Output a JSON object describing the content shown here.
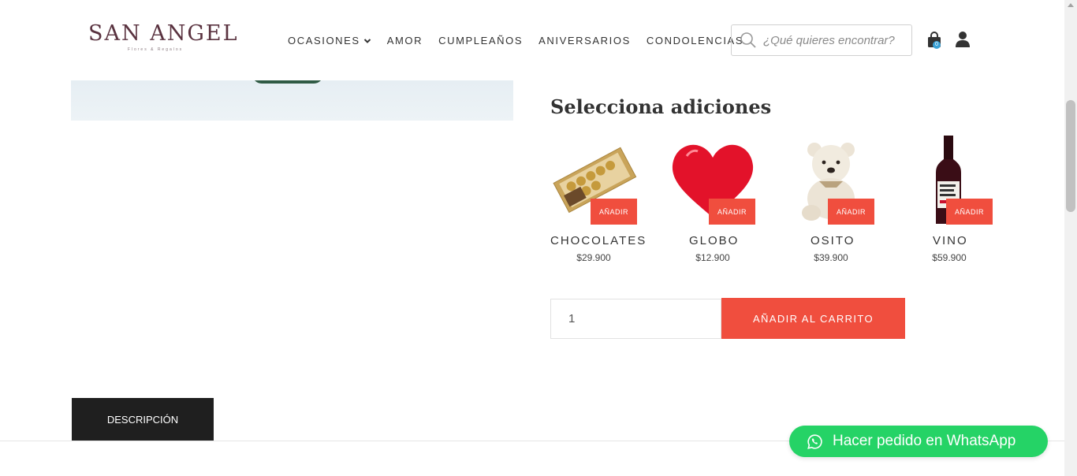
{
  "header": {
    "logo_text": "SAN ANGEL",
    "logo_subtitle": "Flores & Regalos",
    "nav": [
      {
        "label": "OCASIONES",
        "has_dropdown": true
      },
      {
        "label": "AMOR"
      },
      {
        "label": "CUMPLEAÑOS"
      },
      {
        "label": "ANIVERSARIOS"
      },
      {
        "label": "CONDOLENCIAS"
      }
    ],
    "search": {
      "placeholder": "¿Qué quieres encontrar?",
      "icon": "search-icon"
    },
    "cart": {
      "icon": "shopping-bag-icon",
      "count": "0"
    },
    "user_icon": "user-icon"
  },
  "additions": {
    "title": "Selecciona adiciones",
    "button_label": "AÑADIR",
    "items": [
      {
        "name": "CHOCOLATES",
        "price": "$29.900"
      },
      {
        "name": "GLOBO",
        "price": "$12.900"
      },
      {
        "name": "OSITO",
        "price": "$39.900"
      },
      {
        "name": "VINO",
        "price": "$59.900"
      }
    ]
  },
  "purchase": {
    "quantity": "1",
    "add_to_cart_label": "AÑADIR AL CARRITO"
  },
  "tabs": {
    "description_label": "DESCRIPCIÓN"
  },
  "whatsapp": {
    "label": "Hacer pedido en WhatsApp"
  },
  "colors": {
    "accent": "#f04e3e",
    "whatsapp": "#25d366",
    "logo": "#5a3340",
    "tab_bg": "#1f1f1f"
  }
}
